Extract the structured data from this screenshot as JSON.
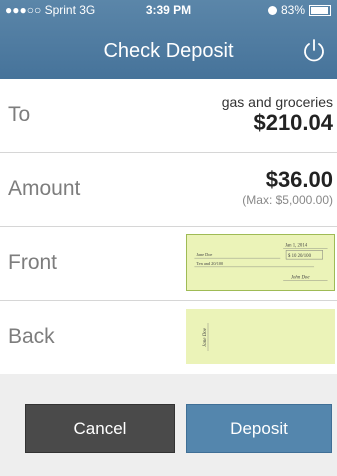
{
  "status_bar": {
    "carrier": "●●●○○ Sprint  3G",
    "time": "3:39 PM",
    "battery": "83%",
    "battery_level": 0.83
  },
  "header": {
    "title": "Check Deposit",
    "power_icon": "power-icon"
  },
  "rows": {
    "to": {
      "label": "To",
      "account_name": "gas and groceries",
      "balance": "$210.04"
    },
    "amount": {
      "label": "Amount",
      "value": "$36.00",
      "max_note": "(Max: $5,000.00)"
    },
    "front": {
      "label": "Front",
      "check": {
        "date": "Jan 1, 2014",
        "payee": "Jane Doe",
        "amount_box": "$ 10 20/100",
        "written_amount": "Ten and 20/100",
        "signature": "John Doe"
      }
    },
    "back": {
      "label": "Back",
      "endorsement": "Jane Doe"
    }
  },
  "buttons": {
    "cancel": "Cancel",
    "deposit": "Deposit"
  },
  "colors": {
    "header": "#4f7ca1",
    "deposit_button": "#5486ad",
    "cancel_button": "#4a4a4a",
    "check": "#ebf3b8"
  }
}
